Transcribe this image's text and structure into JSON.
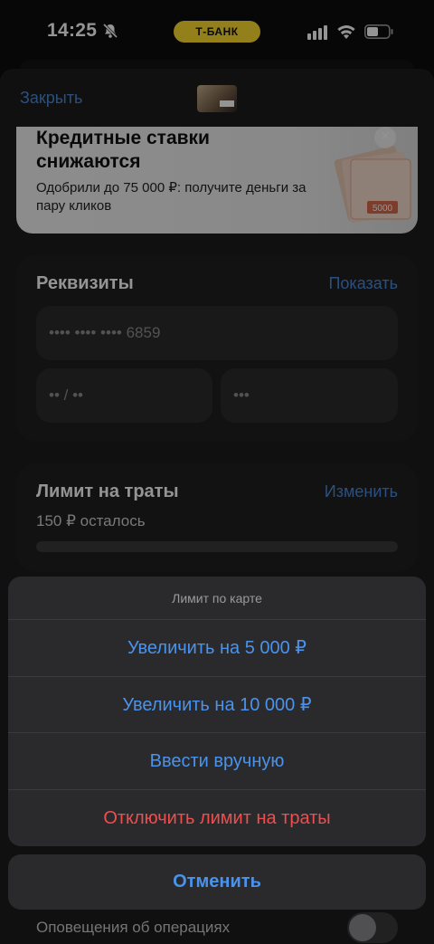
{
  "status_bar": {
    "time": "14:25",
    "carrier_pill": "Т-БАНК"
  },
  "header": {
    "close_label": "Закрыть"
  },
  "promo": {
    "title": "Кредитные ставки снижаются",
    "subtitle": "Одобрили до 75 000 ₽: получите деньги за пару кликов",
    "money_label": "5000"
  },
  "requisites": {
    "title": "Реквизиты",
    "show_label": "Показать",
    "card_number": "•••• •••• •••• 6859",
    "expiry": "•• / ••",
    "cvv": "•••"
  },
  "limit": {
    "title": "Лимит на траты",
    "change_label": "Изменить",
    "remaining": "150 ₽ осталось",
    "progress_fraction": 0.0
  },
  "action_sheet": {
    "title": "Лимит по карте",
    "items": [
      {
        "label": "Увеличить на 5 000 ₽"
      },
      {
        "label": "Увеличить на 10 000 ₽"
      },
      {
        "label": "Ввести вручную"
      },
      {
        "label": "Отключить лимит на траты"
      }
    ],
    "cancel_label": "Отменить"
  },
  "notifications": {
    "label": "Оповещения об операциях",
    "enabled": false
  },
  "colors": {
    "accent": "#4a93ec",
    "destructive": "#ef4e4e",
    "brand": "#ffdd2d"
  }
}
